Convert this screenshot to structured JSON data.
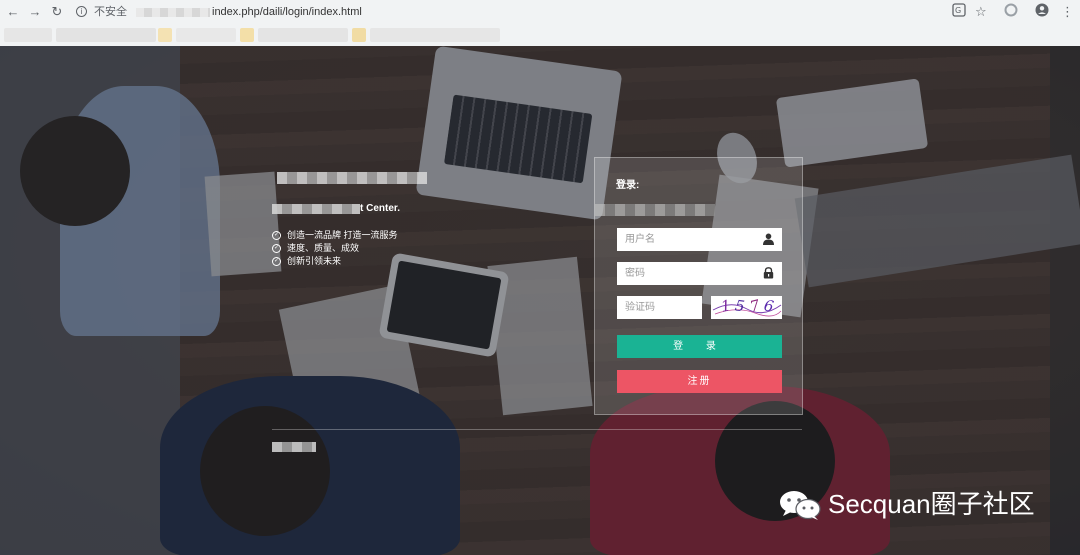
{
  "browser": {
    "security_label": "不安全",
    "url": "index.php/daili/login/index.html",
    "icons": [
      "back-icon",
      "forward-icon",
      "reload-icon",
      "info-icon",
      "translate-icon",
      "star-icon",
      "extension-icon",
      "account-icon",
      "menu-icon"
    ]
  },
  "brand": {
    "subtitle": "t Center.",
    "features": [
      "创造一流品牌 打造一流服务",
      "速度、质量、成效",
      "创新引领未来"
    ]
  },
  "login": {
    "title": "登录:",
    "username_placeholder": "用户名",
    "password_placeholder": "密码",
    "captcha_placeholder": "验证码",
    "captcha_chars": [
      "1",
      "5",
      "7",
      "6"
    ],
    "login_button": "登 录",
    "register_button": "注册",
    "colors": {
      "login": "#1ab394",
      "register": "#ed5565"
    }
  },
  "watermark": {
    "text": "Secquan圈子社区",
    "icon": "wechat-icon"
  }
}
